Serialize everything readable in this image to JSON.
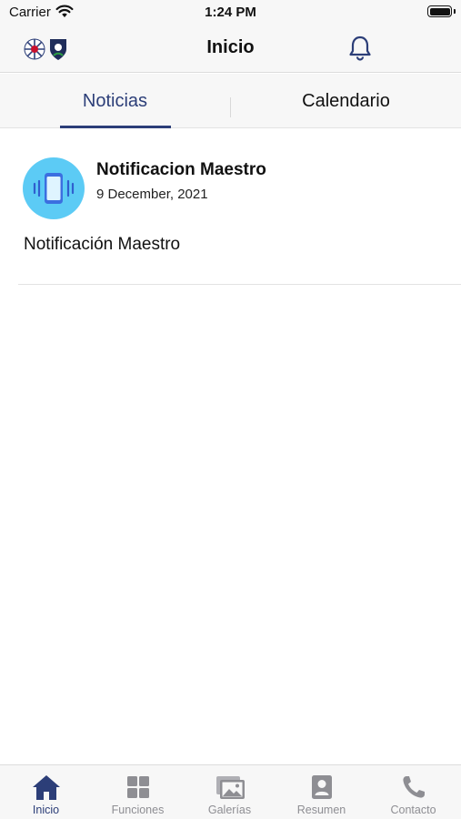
{
  "status_bar": {
    "carrier": "Carrier",
    "time": "1:24 PM",
    "wifi_icon": "wifi-icon",
    "battery_icon": "battery-icon"
  },
  "nav_bar": {
    "title": "Inicio",
    "logo_icon": "school-logos",
    "bell_icon": "bell-icon"
  },
  "tabs": [
    {
      "label": "Noticias",
      "selected": true
    },
    {
      "label": "Calendario",
      "selected": false
    }
  ],
  "news": [
    {
      "icon": "vibrating-phone-icon",
      "title": "Notificacion Maestro",
      "date": "9 December, 2021",
      "body": "Notificación Maestro"
    }
  ],
  "tab_bar": {
    "items": [
      {
        "label": "Inicio",
        "icon": "home-icon",
        "active": true
      },
      {
        "label": "Funciones",
        "icon": "grid-icon",
        "active": false
      },
      {
        "label": "Galerías",
        "icon": "gallery-icon",
        "active": false
      },
      {
        "label": "Resumen",
        "icon": "profile-card-icon",
        "active": false
      },
      {
        "label": "Contacto",
        "icon": "phone-icon",
        "active": false
      }
    ]
  },
  "colors": {
    "accent": "#2c3e78",
    "inactive": "#8e8e93",
    "avatar_bg": "#5ccbf5",
    "bar_bg": "#f7f7f7"
  }
}
